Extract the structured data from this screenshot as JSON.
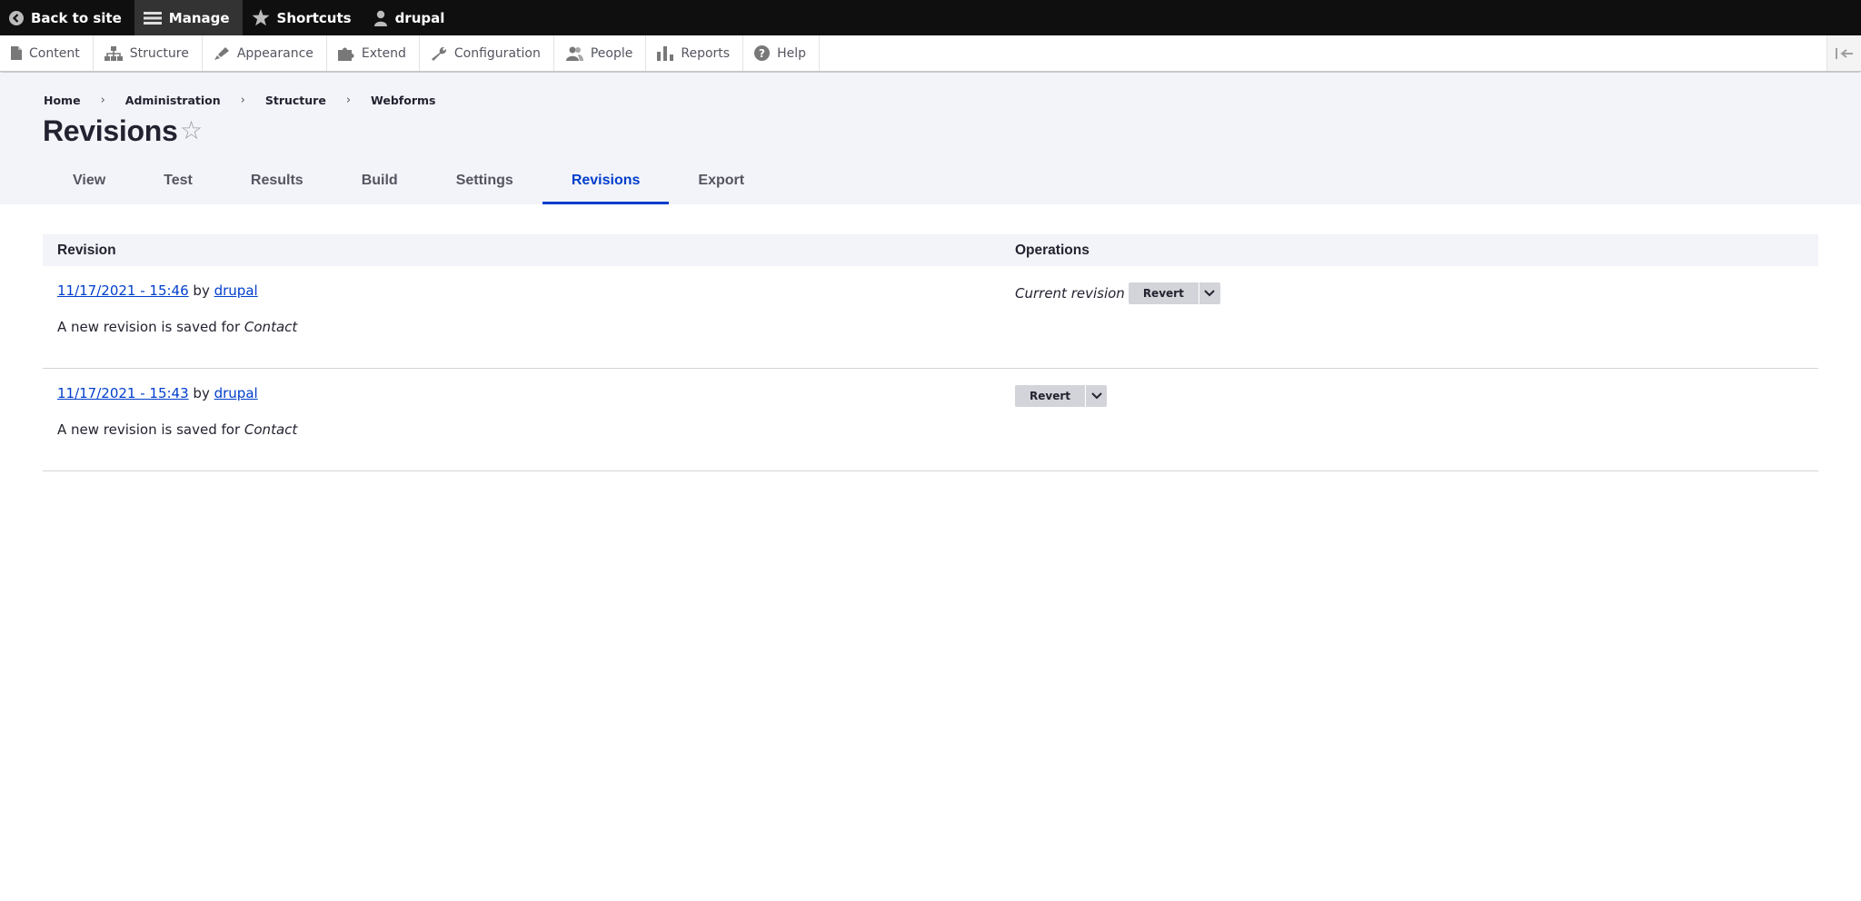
{
  "toolbar": {
    "items": [
      {
        "label": "Back to site",
        "icon": "back-arrow-icon"
      },
      {
        "label": "Manage",
        "icon": "hamburger-icon",
        "active": true
      },
      {
        "label": "Shortcuts",
        "icon": "star-icon"
      },
      {
        "label": "drupal",
        "icon": "user-icon"
      }
    ]
  },
  "tray": {
    "items": [
      {
        "label": "Content",
        "icon": "document-icon"
      },
      {
        "label": "Structure",
        "icon": "sitemap-icon"
      },
      {
        "label": "Appearance",
        "icon": "paintbrush-icon"
      },
      {
        "label": "Extend",
        "icon": "puzzle-icon"
      },
      {
        "label": "Configuration",
        "icon": "wrench-icon"
      },
      {
        "label": "People",
        "icon": "people-icon"
      },
      {
        "label": "Reports",
        "icon": "bar-chart-icon"
      },
      {
        "label": "Help",
        "icon": "help-icon"
      }
    ]
  },
  "breadcrumb": [
    "Home",
    "Administration",
    "Structure",
    "Webforms"
  ],
  "breadcrumb_separator": "›",
  "page": {
    "title": "Revisions",
    "favorite_glyph": "☆"
  },
  "tabs": [
    {
      "label": "View"
    },
    {
      "label": "Test"
    },
    {
      "label": "Results"
    },
    {
      "label": "Build"
    },
    {
      "label": "Settings"
    },
    {
      "label": "Revisions",
      "active": true
    },
    {
      "label": "Export"
    }
  ],
  "table": {
    "headers": {
      "revision": "Revision",
      "operations": "Operations"
    },
    "rows": [
      {
        "date": "11/17/2021 - 15:46",
        "by": "by",
        "author": "drupal",
        "message_prefix": "A new revision is saved for",
        "message_subject": "Contact",
        "current_label": "Current revision",
        "action": "Revert"
      },
      {
        "date": "11/17/2021 - 15:43",
        "by": "by",
        "author": "drupal",
        "message_prefix": "A new revision is saved for",
        "message_subject": "Contact",
        "current_label": "",
        "action": "Revert"
      }
    ]
  },
  "colors": {
    "accent": "#003ecc",
    "toolbar": "#0f0f0f",
    "header_bg": "#f3f4f9"
  }
}
